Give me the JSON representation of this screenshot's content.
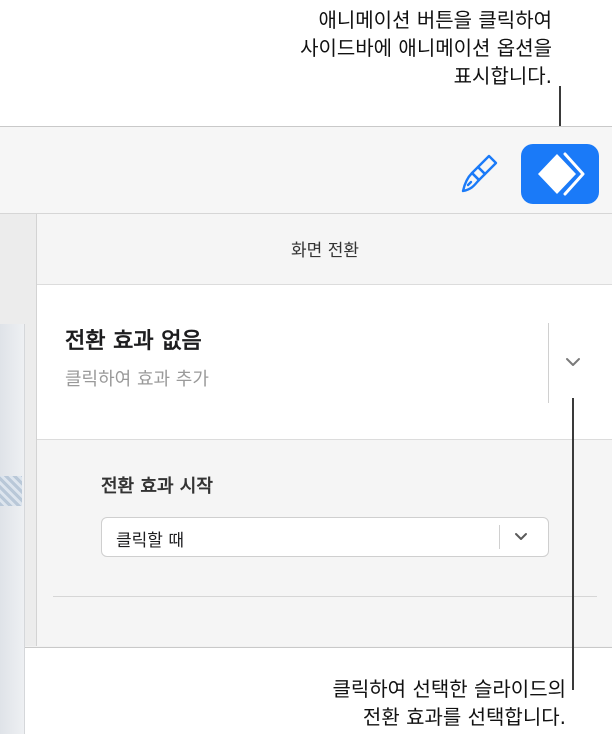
{
  "callouts": {
    "top_lines": [
      "애니메이션 버튼을 클릭하여",
      "사이드바에 애니메이션 옵션을",
      "표시합니다."
    ],
    "bottom_lines": [
      "클릭하여 선택한 슬라이드의",
      "전환 효과를 선택합니다."
    ]
  },
  "toolbar": {
    "format_icon": "paintbrush-icon",
    "animate_icon": "animate-diamond-icon",
    "accent_color": "#1a7af8"
  },
  "sidebar": {
    "title": "화면 전환",
    "effect": {
      "name": "전환 효과 없음",
      "hint": "클릭하여 효과 추가",
      "chevron_icon": "chevron-down-icon"
    },
    "start": {
      "label": "전환 효과 시작",
      "value": "클릭할 때",
      "chevron_icon": "chevron-down-icon"
    }
  }
}
